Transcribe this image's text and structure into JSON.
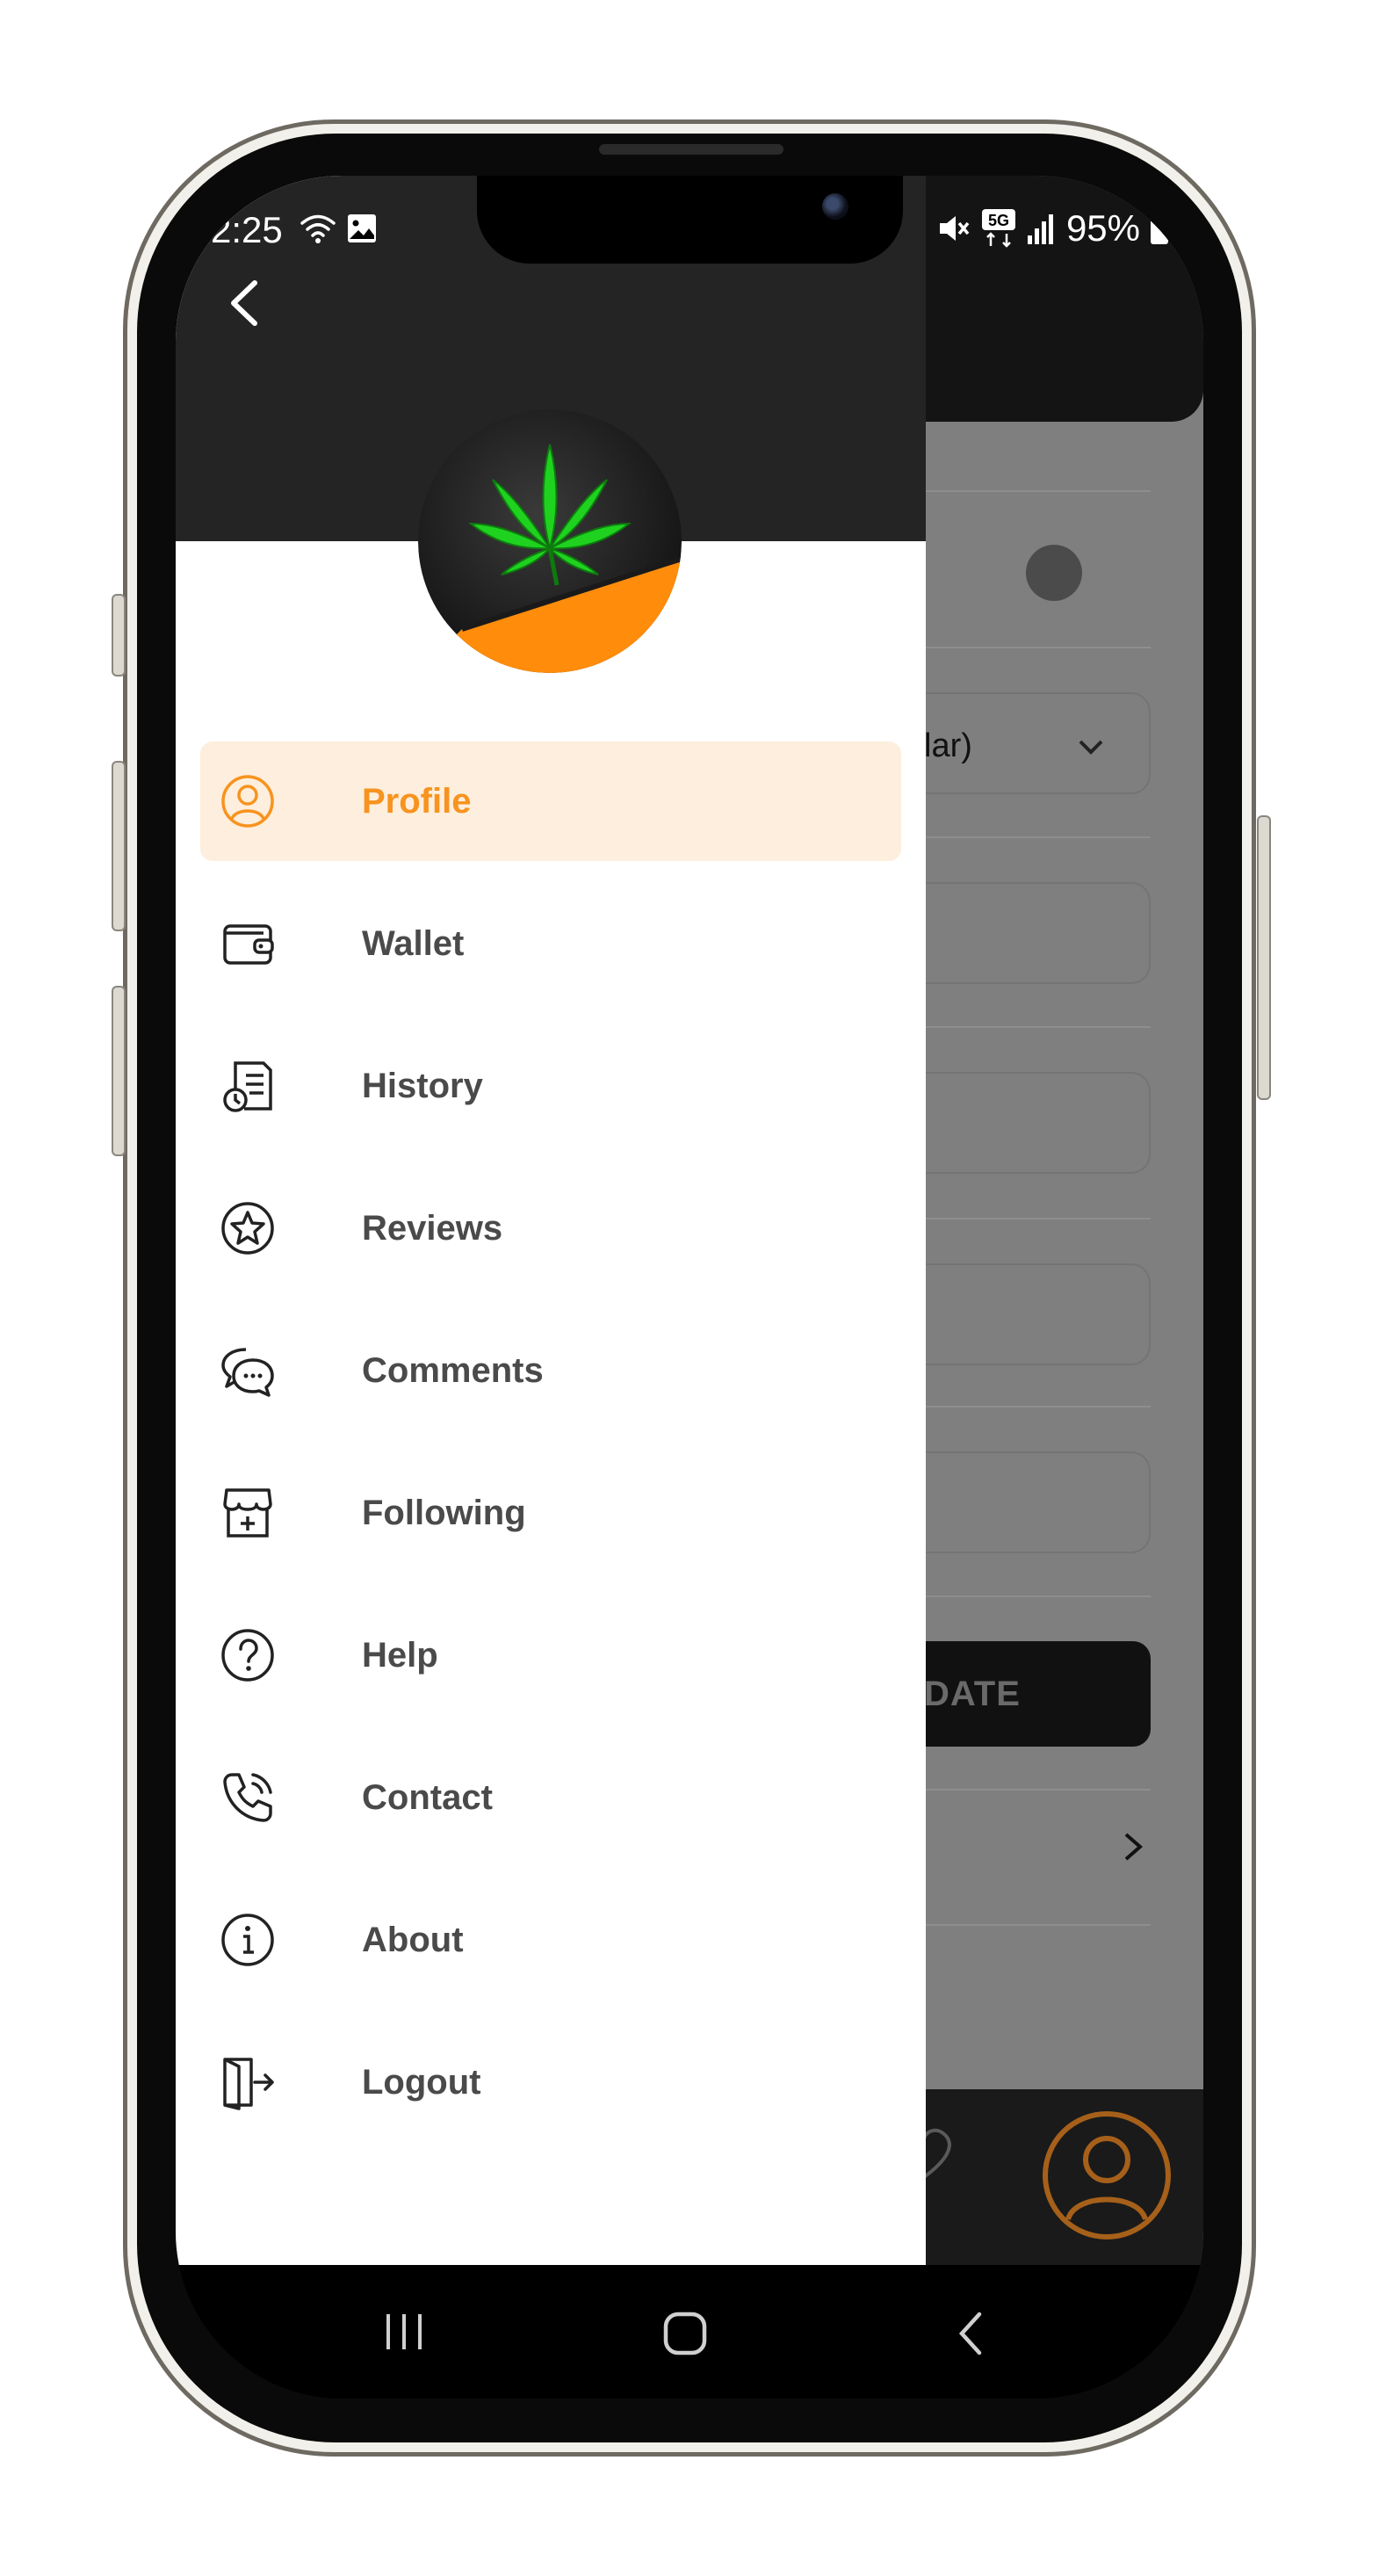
{
  "status_bar": {
    "time": "2:25",
    "battery": "95%",
    "network": "5G"
  },
  "background_screen": {
    "select_partial_text": "lar)",
    "button_partial_label": "DATE"
  },
  "drawer": {
    "menu": [
      {
        "label": "Profile",
        "icon": "user-circle-icon",
        "active": true
      },
      {
        "label": "Wallet",
        "icon": "wallet-icon",
        "active": false
      },
      {
        "label": "History",
        "icon": "history-icon",
        "active": false
      },
      {
        "label": "Reviews",
        "icon": "star-circle-icon",
        "active": false
      },
      {
        "label": "Comments",
        "icon": "chat-bubbles-icon",
        "active": false
      },
      {
        "label": "Following",
        "icon": "store-icon",
        "active": false
      },
      {
        "label": "Help",
        "icon": "question-circle-icon",
        "active": false
      },
      {
        "label": "Contact",
        "icon": "phone-icon",
        "active": false
      },
      {
        "label": "About",
        "icon": "info-circle-icon",
        "active": false
      },
      {
        "label": "Logout",
        "icon": "logout-door-icon",
        "active": false
      }
    ]
  },
  "colors": {
    "accent": "#f7931e",
    "active_bg": "#fdeedd",
    "drawer_header": "#242424",
    "overlay": "#7f7f7f"
  }
}
